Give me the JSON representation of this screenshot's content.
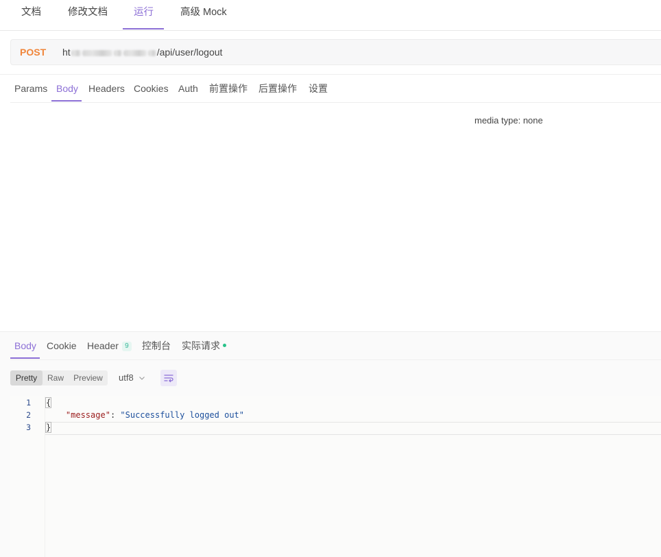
{
  "top_tabs": [
    "文档",
    "修改文档",
    "运行",
    "高级 Mock"
  ],
  "request": {
    "method": "POST",
    "url_prefix": "ht",
    "url_path": "/api/user/logout"
  },
  "request_tabs": [
    "Params",
    "Body",
    "Headers",
    "Cookies",
    "Auth",
    "前置操作",
    "后置操作",
    "设置"
  ],
  "body_media_type": "media type: none",
  "response": {
    "tabs": [
      "Body",
      "Cookie",
      "Header",
      "控制台",
      "实际请求"
    ],
    "header_count": "9",
    "view_modes": [
      "Pretty",
      "Raw",
      "Preview"
    ],
    "encoding": "utf8",
    "code": {
      "line_numbers": [
        "1",
        "2",
        "3"
      ],
      "open_brace": "{",
      "indent": "    ",
      "key": "\"message\"",
      "colon": ": ",
      "value": "\"Successfully logged out\"",
      "close_brace": "}"
    }
  },
  "colors": {
    "accent": "#8c6fd6",
    "method_post": "#f0853a",
    "status_dot": "#27c289"
  },
  "icons": {
    "encoding_dropdown": "chevron-down-icon",
    "wrap_toggle": "wrap-lines-icon"
  }
}
